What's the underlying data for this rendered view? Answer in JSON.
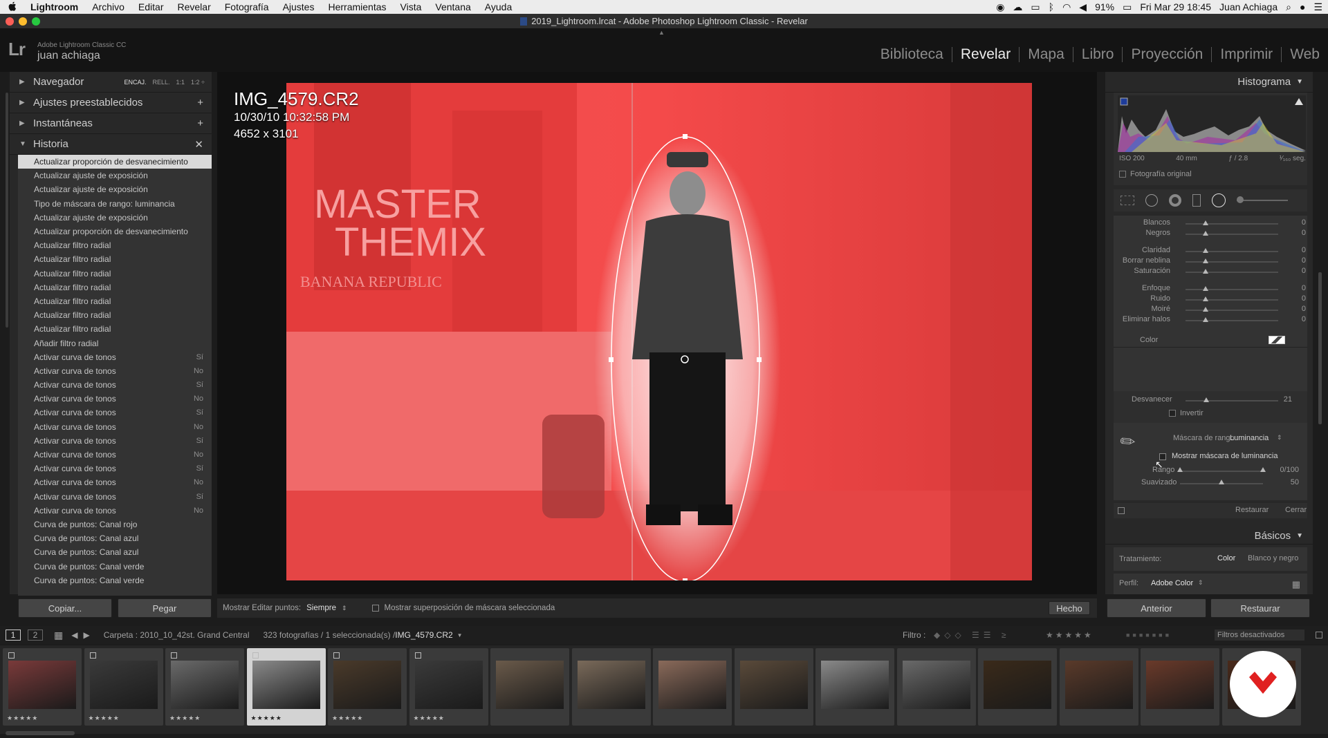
{
  "menubar": {
    "apple": "",
    "app": "Lightroom",
    "items": [
      "Archivo",
      "Editar",
      "Revelar",
      "Fotografía",
      "Ajustes",
      "Herramientas",
      "Vista",
      "Ventana",
      "Ayuda"
    ],
    "battery": "91%",
    "clock": "Fri Mar 29  18:45",
    "user": "Juan Achiaga"
  },
  "window": {
    "title": "2019_Lightroom.lrcat - Adobe Photoshop Lightroom Classic - Revelar"
  },
  "identity": {
    "logo": "Lr",
    "product": "Adobe Lightroom Classic CC",
    "user": "juan achiaga"
  },
  "modules": [
    {
      "label": "Biblioteca"
    },
    {
      "label": "Revelar"
    },
    {
      "label": "Mapa"
    },
    {
      "label": "Libro"
    },
    {
      "label": "Proyección"
    },
    {
      "label": "Imprimir"
    },
    {
      "label": "Web"
    }
  ],
  "left": {
    "navegador": "Navegador",
    "nav_opts": [
      "ENCAJ.",
      "RELL.",
      "1:1",
      "1:2 ÷"
    ],
    "ajustes": "Ajustes preestablecidos",
    "instantaneas": "Instantáneas",
    "historia": "Historia",
    "plus": "+",
    "close": "✕",
    "history": [
      {
        "label": "Actualizar proporción de desvanecimiento",
        "value": ""
      },
      {
        "label": "Actualizar ajuste de exposición",
        "value": ""
      },
      {
        "label": "Actualizar ajuste de exposición",
        "value": ""
      },
      {
        "label": "Tipo de máscara de rango: luminancia",
        "value": ""
      },
      {
        "label": "Actualizar ajuste de exposición",
        "value": ""
      },
      {
        "label": "Actualizar proporción de desvanecimiento",
        "value": ""
      },
      {
        "label": "Actualizar filtro radial",
        "value": ""
      },
      {
        "label": "Actualizar filtro radial",
        "value": ""
      },
      {
        "label": "Actualizar filtro radial",
        "value": ""
      },
      {
        "label": "Actualizar filtro radial",
        "value": ""
      },
      {
        "label": "Actualizar filtro radial",
        "value": ""
      },
      {
        "label": "Actualizar filtro radial",
        "value": ""
      },
      {
        "label": "Actualizar filtro radial",
        "value": ""
      },
      {
        "label": "Añadir filtro radial",
        "value": ""
      },
      {
        "label": "Activar curva de tonos",
        "value": "Sí"
      },
      {
        "label": "Activar curva de tonos",
        "value": "No"
      },
      {
        "label": "Activar curva de tonos",
        "value": "Sí"
      },
      {
        "label": "Activar curva de tonos",
        "value": "No"
      },
      {
        "label": "Activar curva de tonos",
        "value": "Sí"
      },
      {
        "label": "Activar curva de tonos",
        "value": "No"
      },
      {
        "label": "Activar curva de tonos",
        "value": "Sí"
      },
      {
        "label": "Activar curva de tonos",
        "value": "No"
      },
      {
        "label": "Activar curva de tonos",
        "value": "Sí"
      },
      {
        "label": "Activar curva de tonos",
        "value": "No"
      },
      {
        "label": "Activar curva de tonos",
        "value": "Sí"
      },
      {
        "label": "Activar curva de tonos",
        "value": "No"
      },
      {
        "label": "Curva de puntos: Canal rojo",
        "value": ""
      },
      {
        "label": "Curva de puntos: Canal azul",
        "value": ""
      },
      {
        "label": "Curva de puntos: Canal azul",
        "value": ""
      },
      {
        "label": "Curva de puntos: Canal verde",
        "value": ""
      },
      {
        "label": "Curva de puntos: Canal verde",
        "value": ""
      }
    ],
    "copy": "Copiar...",
    "paste": "Pegar"
  },
  "photo": {
    "name": "IMG_4579.CR2",
    "date": "10/30/10 10:32:58 PM",
    "dims": "4652 x 3101",
    "sign1": "MASTER",
    "sign2": "THEMIX",
    "sign3": "BANANA REPUBLIC"
  },
  "toolbar": {
    "show_label": "Mostrar Editar puntos:",
    "show_value": "Siempre",
    "overlay_label": "Mostrar superposición de máscara seleccionada",
    "done": "Hecho"
  },
  "right": {
    "histogram": "Histograma",
    "iso": "ISO 200",
    "focal": "40 mm",
    "aperture": "ƒ / 2.8",
    "shutter": "¹⁄₁₆₀ seg.",
    "original": "Fotografía original",
    "sliders": [
      {
        "label": "Blancos",
        "value": "0"
      },
      {
        "label": "Negros",
        "value": "0"
      },
      {
        "label": "Claridad",
        "value": "0"
      },
      {
        "label": "Borrar neblina",
        "value": "0"
      },
      {
        "label": "Saturación",
        "value": "0"
      },
      {
        "label": "Enfoque",
        "value": "0"
      },
      {
        "label": "Ruido",
        "value": "0"
      },
      {
        "label": "Moiré",
        "value": "0"
      },
      {
        "label": "Eliminar halos",
        "value": "0"
      }
    ],
    "color": "Color",
    "desvanecer": "Desvanecer",
    "desvanecer_val": "21",
    "invertir": "Invertir",
    "range_mask": "Máscara de rango :",
    "range_mask_value": "Luminancia",
    "show_lum": "Mostrar máscara de luminancia",
    "rango": "Rango",
    "rango_val": "0/100",
    "suavizado": "Suavizado",
    "suavizado_val": "50",
    "restaurar": "Restaurar",
    "cerrar": "Cerrar",
    "basicos": "Básicos",
    "tratamiento": "Tratamiento:",
    "t_color": "Color",
    "t_bw": "Blanco y negro",
    "perfil": "Perfil:",
    "perfil_val": "Adobe Color",
    "anterior": "Anterior",
    "restaurar_btn": "Restaurar"
  },
  "filmbar": {
    "one": "1",
    "two": "2",
    "folder": "Carpeta : 2010_10_42st. Grand Central",
    "count": "323 fotografías / 1 seleccionada(s) /",
    "file": "IMG_4579.CR2",
    "filtro": "Filtro :",
    "filters_off": "Filtros desactivados"
  },
  "film": {
    "stars": "★★★★★",
    "count": 16,
    "selected": 3
  }
}
